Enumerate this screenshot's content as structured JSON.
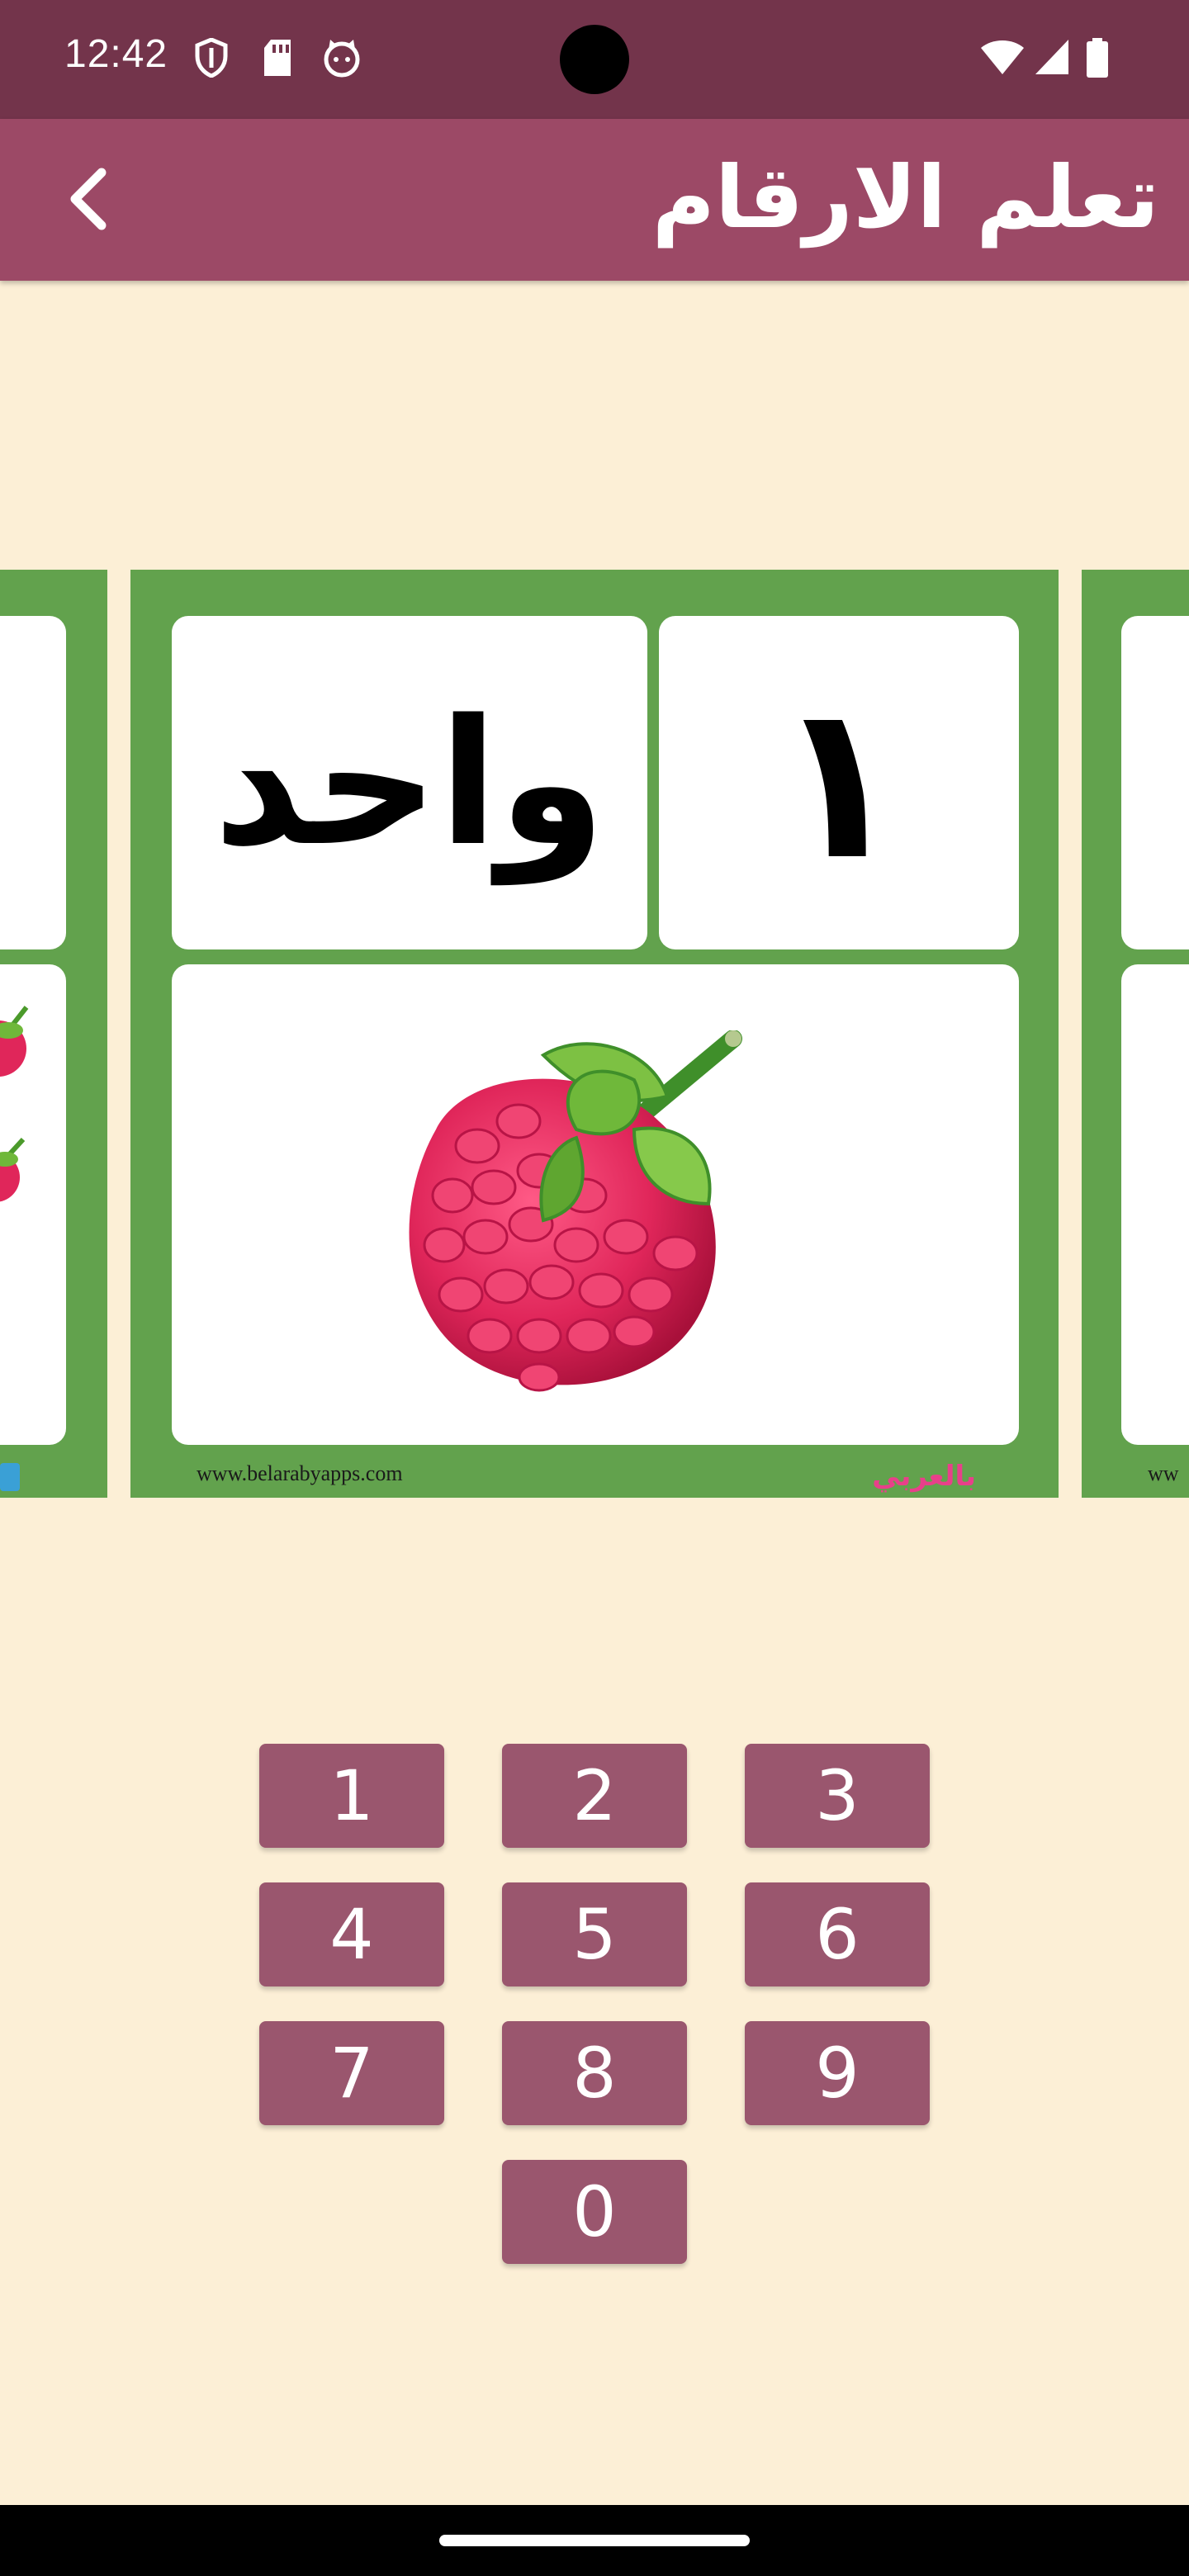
{
  "status_bar": {
    "time": "12:42",
    "left_icons": [
      "shield-icon",
      "sd-card-icon",
      "cat-icon"
    ],
    "right_icons": [
      "wifi-icon",
      "signal-icon",
      "battery-icon"
    ]
  },
  "app_bar": {
    "title": "تعلم الارقام",
    "back_icon": "chevron-left-icon"
  },
  "card": {
    "digit": "١",
    "word": "واحد",
    "picture": "raspberry",
    "url": "www.belarabyapps.com",
    "logo": "بالعربي"
  },
  "keypad": {
    "keys": [
      "1",
      "2",
      "3",
      "4",
      "5",
      "6",
      "7",
      "8",
      "9",
      "0"
    ]
  },
  "colors": {
    "status_bar": "#73344b",
    "app_bar": "#9c4966",
    "background": "#fcefd6",
    "card_green": "#62a24d",
    "key": "#9a566e"
  }
}
